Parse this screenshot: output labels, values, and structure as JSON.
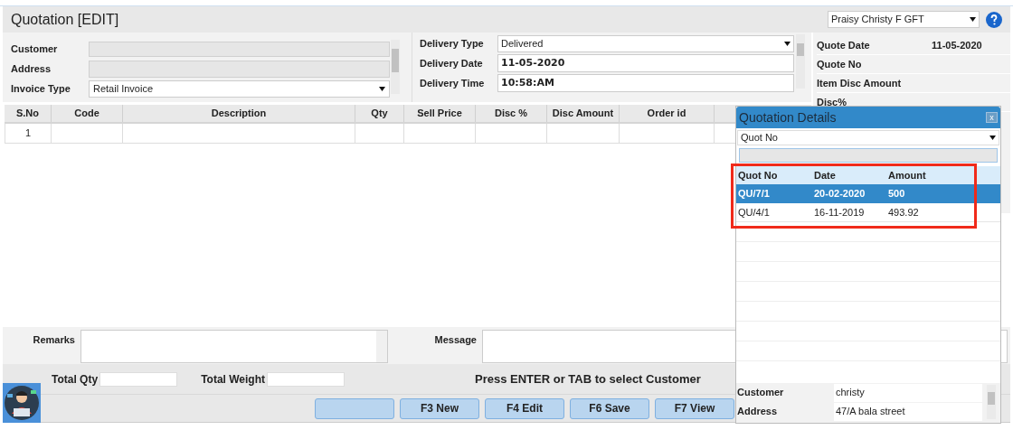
{
  "header": {
    "title": "Quotation [EDIT]",
    "user": "Praisy Christy F GFT"
  },
  "form": {
    "customer_label": "Customer",
    "address_label": "Address",
    "invoice_type_label": "Invoice Type",
    "invoice_type": "Retail Invoice",
    "delivery": [
      {
        "label": "Delivery Type",
        "value": "Delivered",
        "kind": "select"
      },
      {
        "label": "Delivery Date",
        "value": "11-05-2020",
        "kind": "text"
      },
      {
        "label": "Delivery Time",
        "value": "10:58:AM",
        "kind": "text"
      }
    ]
  },
  "summary": [
    {
      "label": "Quote Date",
      "value": "11-05-2020"
    },
    {
      "label": "Quote No"
    },
    {
      "label": "Item Disc Amount"
    },
    {
      "label": "Disc%"
    }
  ],
  "grid": {
    "columns": [
      "S.No",
      "Code",
      "Description",
      "Qty",
      "Sell Price",
      "Disc %",
      "Disc Amount",
      "Order id"
    ],
    "rows": [
      [
        "1",
        "",
        "",
        "",
        "",
        "",
        "",
        ""
      ]
    ]
  },
  "remarks_label": "Remarks",
  "message_label": "Message",
  "totals": {
    "qty_label": "Total Qty",
    "weight_label": "Total Weight",
    "hint": "Press ENTER or TAB to select Customer"
  },
  "buttons": [
    "F3 New",
    "F4 Edit",
    "F6 Save",
    "F7 View"
  ],
  "popup": {
    "title": "Quotation Details",
    "close": "x",
    "search_by": "Quot No",
    "columns": [
      "Quot No",
      "Date",
      "Amount"
    ],
    "rows": [
      {
        "cells": [
          "QU/7/1",
          "20-02-2020",
          "500"
        ],
        "selected": true
      },
      {
        "cells": [
          "QU/4/1",
          "16-11-2019",
          "493.92"
        ],
        "selected": false
      }
    ],
    "details": [
      {
        "label": "Customer",
        "value": "christy"
      },
      {
        "label": "Address",
        "value": "47/A bala street"
      }
    ]
  }
}
